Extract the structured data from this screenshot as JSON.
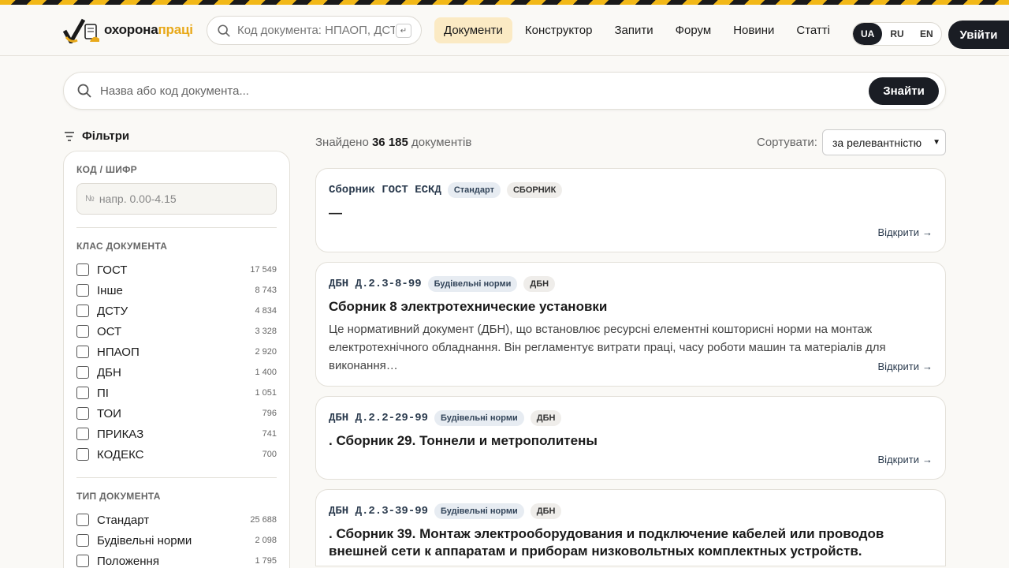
{
  "header": {
    "logo": {
      "text_a": "охорона",
      "text_b": "праці"
    },
    "search": {
      "placeholder": "Код документа: НПАОП, ДСТУ",
      "enter_key": "↵"
    },
    "nav": [
      "Документи",
      "Конструктор",
      "Запити",
      "Форум",
      "Новини",
      "Статті"
    ],
    "nav_active": "Документи",
    "languages": [
      "UA",
      "RU",
      "EN"
    ],
    "active_language": "UA",
    "login_label": "Увійти"
  },
  "main_search": {
    "placeholder": "Назва або код документа...",
    "button_label": "Знайти"
  },
  "filters": {
    "title": "Фільтри",
    "code_section": {
      "label": "КОД / ШИФР",
      "prefix": "№",
      "placeholder": "напр. 0.00-4.15"
    },
    "class_section": {
      "label": "КЛАС ДОКУМЕНТА",
      "items": [
        {
          "name": "ГОСТ",
          "count": "17 549"
        },
        {
          "name": "Інше",
          "count": "8 743"
        },
        {
          "name": "ДСТУ",
          "count": "4 834"
        },
        {
          "name": "ОСТ",
          "count": "3 328"
        },
        {
          "name": "НПАОП",
          "count": "2 920"
        },
        {
          "name": "ДБН",
          "count": "1 400"
        },
        {
          "name": "ПІ",
          "count": "1 051"
        },
        {
          "name": "ТОИ",
          "count": "796"
        },
        {
          "name": "ПРИКАЗ",
          "count": "741"
        },
        {
          "name": "КОДЕКС",
          "count": "700"
        }
      ]
    },
    "type_section": {
      "label": "ТИП ДОКУМЕНТА",
      "items": [
        {
          "name": "Стандарт",
          "count": "25 688"
        },
        {
          "name": "Будівельні норми",
          "count": "2 098"
        },
        {
          "name": "Положення",
          "count": "1 795"
        }
      ]
    }
  },
  "results": {
    "found_prefix": "Знайдено",
    "found_count": "36 185",
    "found_suffix": "документів",
    "sort_label": "Сортувати:",
    "sort_value": "за релевантністю",
    "open_label": "Відкрити",
    "items": [
      {
        "code": "Сборник ГОСТ ЕСКД",
        "tag1": "Стандарт",
        "tag2": "СБОРНИК",
        "title": "—",
        "desc": ""
      },
      {
        "code": "ДБН Д.2.3-8-99",
        "tag1": "Будівельні норми",
        "tag2": "ДБН",
        "title": "Сборник 8 электротехнические установки",
        "desc": "Це нормативний документ (ДБН), що встановлює ресурсні елементні кошторисні норми на монтаж електротехнічного обладнання. Він регламентує витрати праці, часу роботи машин та матеріалів для виконання…"
      },
      {
        "code": "ДБН Д.2.2-29-99",
        "tag1": "Будівельні норми",
        "tag2": "ДБН",
        "title": ". Сборник 29. Тоннели и метрополитены",
        "desc": ""
      },
      {
        "code": "ДБН Д.2.3-39-99",
        "tag1": "Будівельні норми",
        "tag2": "ДБН",
        "title": ". Сборник 39. Монтаж электрооборудования и подключение кабелей или проводов внешней сети к аппаратам и приборам низковольтных комплектных устройств.",
        "desc": ""
      }
    ]
  },
  "colors": {
    "accent": "#f2b817",
    "dark": "#1a1d24",
    "nav_active_bg": "#fbeac4"
  }
}
